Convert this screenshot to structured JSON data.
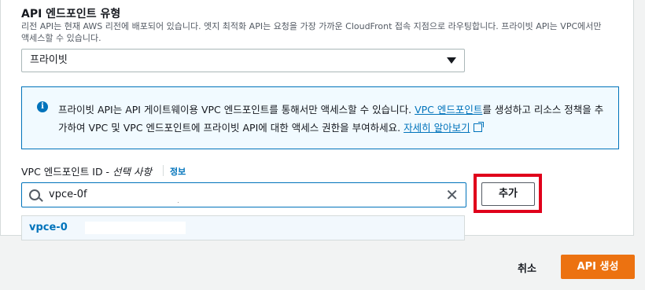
{
  "endpoint_type": {
    "label": "API 엔드포인트 유형",
    "description_line1": "리전 API는 현재 AWS 리전에 배포되어 있습니다. 엣지 최적화 API는 요청을 가장 가까운 CloudFront 접속 지점으로 라우팅합니다. 프라이빗 API는 VPC에서만",
    "description_line2": "액세스할 수 있습니다.",
    "selected": "프라이빗"
  },
  "info_alert": {
    "text_part1": "프라이빗 API는 API 게이트웨이용 VPC 엔드포인트를 통해서만 액세스할 수 있습니다. ",
    "link_vpc": "VPC 엔드포인트",
    "text_part2": "를 생성하고 리소스 정책을 추가하여 VPC 및 VPC 엔드포인트에 프라이빗 API에 대한 액세스 권한을 부여하세요. ",
    "link_more": "자세히 알아보기"
  },
  "vpc_endpoint": {
    "label": "VPC 엔드포인트 ID - ",
    "label_optional": "선택 사항",
    "info_link": "정보",
    "search_value": "vpce-0f",
    "option": "vpce-0",
    "add_button": "추가"
  },
  "footer": {
    "cancel": "취소",
    "create": "API 생성"
  },
  "colors": {
    "link": "#0073bb",
    "primary": "#ec7211",
    "highlight": "#e0001b"
  }
}
